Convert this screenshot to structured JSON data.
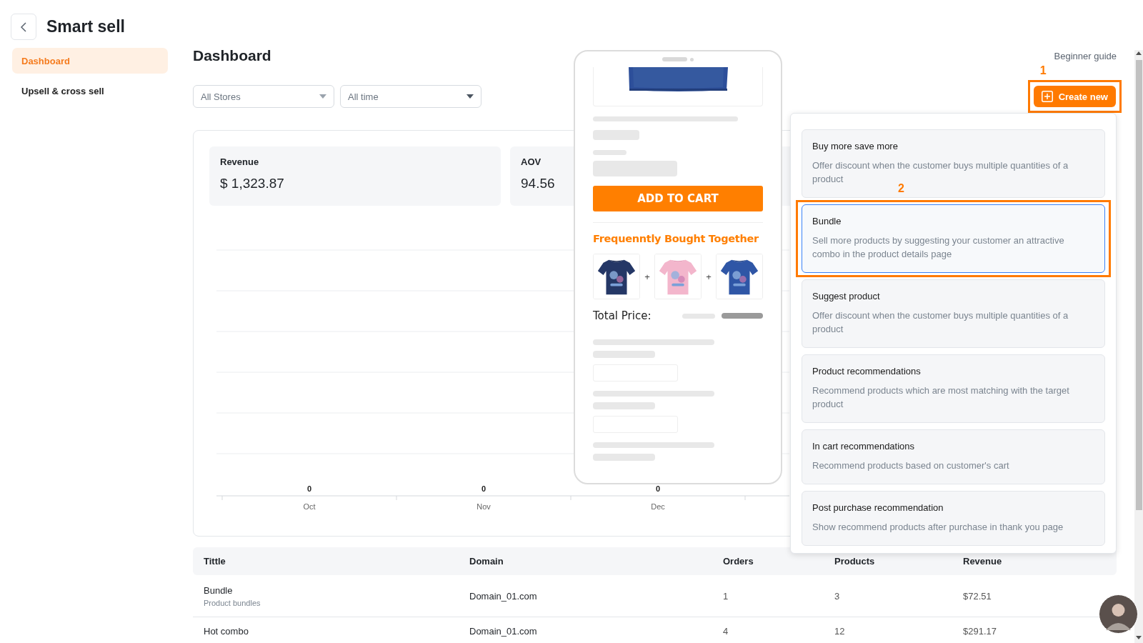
{
  "app": {
    "title": "Smart sell"
  },
  "sidebar": {
    "items": [
      {
        "label": "Dashboard",
        "selected": true
      },
      {
        "label": "Upsell & cross sell",
        "selected": false
      }
    ]
  },
  "page": {
    "heading": "Dashboard",
    "guide_link": "Beginner guide"
  },
  "filters": [
    {
      "value": "All Stores"
    },
    {
      "value": "All time"
    }
  ],
  "create_button": {
    "label": "Create new",
    "annotation": "1"
  },
  "stats": [
    {
      "label": "Revenue",
      "value": "$ 1,323.87"
    },
    {
      "label": "AOV",
      "value": "94.56"
    }
  ],
  "chart": {
    "value_labels": [
      "0",
      "0",
      "0"
    ],
    "x_labels": [
      "Oct",
      "Nov",
      "Dec"
    ]
  },
  "table": {
    "columns": [
      "Tittle",
      "Domain",
      "Orders",
      "Products",
      "Revenue"
    ],
    "rows": [
      {
        "title": "Bundle",
        "subtitle": "Product bundles",
        "domain": "Domain_01.com",
        "orders": "1",
        "products": "3",
        "revenue": "$72.51"
      },
      {
        "title": "Hot combo",
        "domain": "Domain_01.com",
        "orders": "4",
        "products": "12",
        "revenue": "$291.17"
      }
    ]
  },
  "preview": {
    "add_to_cart": "ADD TO CART",
    "section_title": "Frequenntly Bought Together",
    "thumbnails": [
      {
        "kind": "picture"
      },
      {
        "kind": "picture"
      },
      {
        "kind": "picture"
      }
    ],
    "separators": [
      "+",
      "+"
    ],
    "total_label": "Total Price:"
  },
  "create_menu": {
    "items": [
      {
        "title": "Buy more save more",
        "description": "Offer discount when the customer buys multiple quantities of a product",
        "selected": false
      },
      {
        "title": "Bundle",
        "description": "Sell more products by suggesting your customer an attractive combo in the product details page",
        "selected": true,
        "annotation": "2"
      },
      {
        "title": "Suggest product",
        "description": "Offer discount when the customer buys multiple quantities of a product",
        "selected": false
      },
      {
        "title": "Product recommendations",
        "description": "Recommend products which are most matching with the target product",
        "selected": false
      },
      {
        "title": "In cart recommendations",
        "description": "Recommend products based on customer's cart",
        "selected": false
      },
      {
        "title": "Post purchase recommendation",
        "description": "Show recommend products after purchase in thank you page",
        "selected": false
      }
    ]
  }
}
